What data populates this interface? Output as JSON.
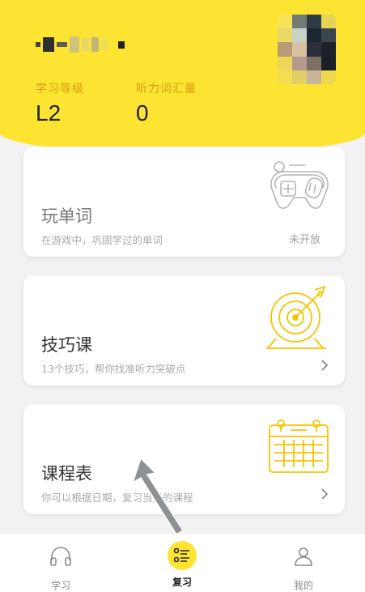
{
  "profile": {
    "username": "",
    "level_label": "学习等级",
    "level_value": "L2",
    "vocab_label": "听力词汇量",
    "vocab_value": "0"
  },
  "cards": [
    {
      "title": "玩单词",
      "subtitle": "在游戏中，巩固学过的单词",
      "status": "未开放",
      "icon": "gamepad-icon"
    },
    {
      "title": "技巧课",
      "subtitle": "13个技巧，帮你找准听力突破点",
      "icon": "target-icon"
    },
    {
      "title": "课程表",
      "subtitle": "你可以根据日期，复习当天的课程",
      "icon": "calendar-icon"
    }
  ],
  "tabs": [
    {
      "label": "学习",
      "icon": "headphones-icon",
      "active": false
    },
    {
      "label": "复习",
      "icon": "review-list-icon",
      "active": true
    },
    {
      "label": "我的",
      "icon": "person-icon",
      "active": false
    }
  ],
  "colors": {
    "brand_yellow": "#fde433",
    "label_gold": "#d79d0a",
    "line_yellow": "#f2c500"
  }
}
